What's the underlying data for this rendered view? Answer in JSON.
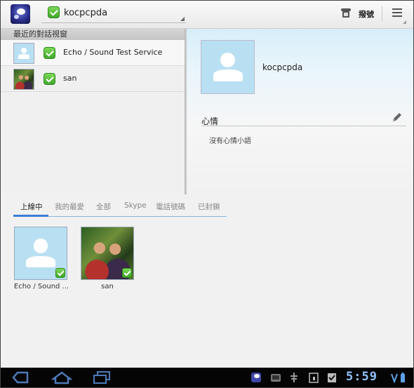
{
  "header": {
    "account_name": "kocpcpda",
    "dial_label": "撥號"
  },
  "recent": {
    "header_label": "最近的對話視窗",
    "items": [
      {
        "name": "Echo / Sound Test Service",
        "avatar": "default-avatar"
      },
      {
        "name": "san",
        "avatar": "photo-avatar"
      }
    ]
  },
  "profile": {
    "name": "kocpcpda",
    "mood_label": "心情",
    "mood_text": "沒有心情小語"
  },
  "tabs": [
    "上線中",
    "我的最愛",
    "全部",
    "Skype",
    "電話號碼",
    "已封鎖"
  ],
  "active_tab": 0,
  "contacts": [
    {
      "name": "Echo / Sound ...",
      "status": "online"
    },
    {
      "name": "san",
      "status": "online"
    }
  ],
  "statusbar": {
    "time": "5:59"
  },
  "colors": {
    "accent": "#3b7fd4",
    "online": "#4cb52f",
    "clock": "#8fc3ff"
  }
}
